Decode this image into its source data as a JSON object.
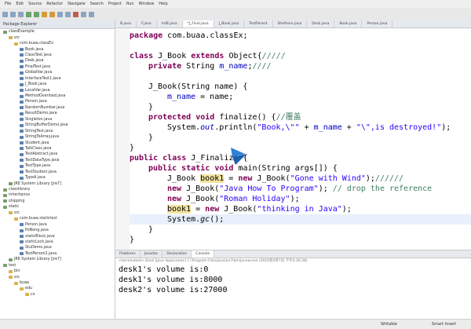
{
  "menu": [
    "File",
    "Edit",
    "Source",
    "Refactor",
    "Navigate",
    "Search",
    "Project",
    "Run",
    "Window",
    "Help"
  ],
  "package_explorer": {
    "title": "Package Explorer",
    "nodes": [
      {
        "t": "classExample",
        "d": 0,
        "k": "p"
      },
      {
        "t": "src",
        "d": 1,
        "k": "f"
      },
      {
        "t": "com.buaa.classEx",
        "d": 2,
        "k": "f"
      },
      {
        "t": "Book.java",
        "d": 3,
        "k": "j"
      },
      {
        "t": "ClassTest.java",
        "d": 3,
        "k": "j"
      },
      {
        "t": "Desk.java",
        "d": 3,
        "k": "j"
      },
      {
        "t": "FinalTest.java",
        "d": 3,
        "k": "j"
      },
      {
        "t": "GlobalVar.java",
        "d": 3,
        "k": "j"
      },
      {
        "t": "InterfaceTest1.java",
        "d": 3,
        "k": "j"
      },
      {
        "t": "J_Book.java",
        "d": 3,
        "k": "j"
      },
      {
        "t": "LocalVar.java",
        "d": 3,
        "k": "j"
      },
      {
        "t": "MethodOverload.java",
        "d": 3,
        "k": "j"
      },
      {
        "t": "Person.java",
        "d": 3,
        "k": "j"
      },
      {
        "t": "RandomNumber.java",
        "d": 3,
        "k": "j"
      },
      {
        "t": "ResultDemo.java",
        "d": 3,
        "k": "j"
      },
      {
        "t": "Singleton.java",
        "d": 3,
        "k": "j"
      },
      {
        "t": "StringBufferDemo.java",
        "d": 3,
        "k": "j"
      },
      {
        "t": "StringTest.java",
        "d": 3,
        "k": "j"
      },
      {
        "t": "StringToArray.java",
        "d": 3,
        "k": "j"
      },
      {
        "t": "Student.java",
        "d": 3,
        "k": "j"
      },
      {
        "t": "TalkClass.java",
        "d": 3,
        "k": "j"
      },
      {
        "t": "TestAbstract.java",
        "d": 3,
        "k": "j"
      },
      {
        "t": "TestDataType.java",
        "d": 3,
        "k": "j"
      },
      {
        "t": "TestType.java",
        "d": 3,
        "k": "j"
      },
      {
        "t": "TestStudent.java",
        "d": 3,
        "k": "j"
      },
      {
        "t": "TypeA.java",
        "d": 3,
        "k": "j"
      },
      {
        "t": "JRE System Library [jre7]",
        "d": 1,
        "k": "p"
      },
      {
        "t": "classlibrary",
        "d": 0,
        "k": "p"
      },
      {
        "t": "inheritance",
        "d": 0,
        "k": "p"
      },
      {
        "t": "shipping",
        "d": 0,
        "k": "p"
      },
      {
        "t": "static",
        "d": 0,
        "k": "p"
      },
      {
        "t": "src",
        "d": 1,
        "k": "f"
      },
      {
        "t": "com.buaa.statictest",
        "d": 2,
        "k": "f"
      },
      {
        "t": "Person.java",
        "d": 3,
        "k": "j"
      },
      {
        "t": "PoNong.java",
        "d": 3,
        "k": "j"
      },
      {
        "t": "staticBlock.java",
        "d": 3,
        "k": "j"
      },
      {
        "t": "staticLock.java",
        "d": 3,
        "k": "j"
      },
      {
        "t": "StuDemo.java",
        "d": 3,
        "k": "j"
      },
      {
        "t": "TestPerson2.java",
        "d": 3,
        "k": "j"
      },
      {
        "t": "JRE System Library [jre7]",
        "d": 1,
        "k": "p"
      },
      {
        "t": "test",
        "d": 0,
        "k": "p"
      },
      {
        "t": "bin",
        "d": 1,
        "k": "f"
      },
      {
        "t": "src",
        "d": 1,
        "k": "f"
      },
      {
        "t": "buaa",
        "d": 2,
        "k": "f"
      },
      {
        "t": "edu",
        "d": 3,
        "k": "f"
      },
      {
        "t": "cn",
        "d": 4,
        "k": "f"
      }
    ]
  },
  "editor": {
    "tabs": [
      "B.java",
      "F.java",
      "IntB.java",
      "*J_Final.java",
      "J_Book.java",
      "TestParent",
      "Shidhero.java",
      "Desk.java",
      "Book.java",
      "Person.java"
    ],
    "active_tab": 3
  },
  "code": {
    "l1_a": "package ",
    "l1_b": "com.buaa.classEx;",
    "l2_kw1": "class ",
    "l2_a": "J_Book ",
    "l2_kw2": "extends ",
    "l2_b": "Object{",
    "l2_c": "/////",
    "l3_kw1": "private ",
    "l3_a": "String ",
    "l3_f": "m_name",
    "l3_b": ";",
    "l3_c": "////",
    "l4_a": "J_Book(String name) {",
    "l5_f": "m_name",
    "l5_a": " = name;",
    "l6_a": "}",
    "l7_kw1": "protected ",
    "l7_kw2": "void ",
    "l7_a": "finalize() {",
    "l7_c": "//覆盖",
    "l8_a": "System.",
    "l8_it": "out",
    "l8_b": ".println(",
    "l8_s1": "\"Book,\\\"\"",
    "l8_d": " + ",
    "l8_f": "m_name",
    "l8_e": " + ",
    "l8_s2": "\"\\\",is destroyed!\"",
    "l8_g": ");",
    "l9_a": "}",
    "l10_a": "}",
    "l11_kw1": "public ",
    "l11_kw2": "class ",
    "l11_a": "J_Finalize {",
    "l12_kw1": "public ",
    "l12_kw2": "static ",
    "l12_kw3": "void ",
    "l12_a": "main(String args[]) {",
    "l13_a": "J_Book ",
    "l13_hl": "book1",
    "l13_b": " = ",
    "l13_kw": "new ",
    "l13_c": "J_Book(",
    "l13_s": "\"Gone with Wind\"",
    "l13_d": ");",
    "l13_cm": "//////",
    "l14_kw": "new ",
    "l14_a": "J_Book(",
    "l14_s": "\"Java How To Program\"",
    "l14_b": "); ",
    "l14_cm": "// drop the reference",
    "l15_kw": "new ",
    "l15_a": "J_Book(",
    "l15_s": "\"Roman Holiday\"",
    "l15_b": ");",
    "l16_hl": "book1",
    "l16_a": " = ",
    "l16_kw": "new ",
    "l16_b": "J_Book(",
    "l16_s": "\"thinking in Java\"",
    "l16_c": ");",
    "l17_a": "System.",
    "l17_it": "gc",
    "l17_b": "();",
    "l18_a": "}",
    "l19_a": "}"
  },
  "console": {
    "tabs": [
      "Problems",
      "Javadoc",
      "Declaration",
      "Console"
    ],
    "active_tab": 3,
    "terminated": "<terminated> Desk [Java Application] C:\\Program Files\\Java\\jre7\\bin\\javaw.exe (2016年6月7日 下午4:26:28)",
    "lines": [
      "desk1's volume is:0",
      "desk1's volume is:8000",
      "desk2's volume is:27000"
    ]
  },
  "status": {
    "writable": "Writable",
    "insert": "Smart Insert"
  }
}
